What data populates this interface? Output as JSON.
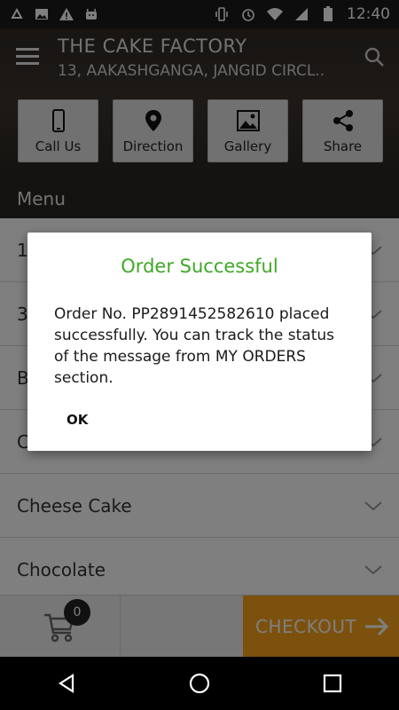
{
  "status_bar": {
    "time": "12:40",
    "left_icons": [
      "recycle-icon",
      "image-icon",
      "warning-icon",
      "android-icon"
    ],
    "right_icons": [
      "vibrate-icon",
      "alarm-icon",
      "wifi-icon",
      "signal-icon",
      "battery-icon"
    ]
  },
  "header": {
    "title": "THE CAKE FACTORY",
    "subtitle": "13, AAKASHGANGA, JANGID CIRCL..",
    "actions": [
      {
        "label": "Call Us",
        "icon": "phone-icon"
      },
      {
        "label": "Direction",
        "icon": "location-pin-icon"
      },
      {
        "label": "Gallery",
        "icon": "gallery-icon"
      },
      {
        "label": "Share",
        "icon": "share-icon"
      }
    ]
  },
  "menu": {
    "header": "Menu",
    "items": [
      {
        "label": "1"
      },
      {
        "label": "3"
      },
      {
        "label": "B"
      },
      {
        "label": "C"
      },
      {
        "label": "Cheese Cake"
      },
      {
        "label": "Chocolate"
      }
    ]
  },
  "bottom_bar": {
    "cart_count": "0",
    "checkout_label": "CHECKOUT"
  },
  "dialog": {
    "title": "Order Successful",
    "message": "Order No. PP2891452582610 placed successfully. You can track the status of the message from MY ORDERS section.",
    "ok_label": "OK"
  },
  "colors": {
    "accent_green": "#3fa826",
    "checkout_orange": "#f7a21a"
  }
}
